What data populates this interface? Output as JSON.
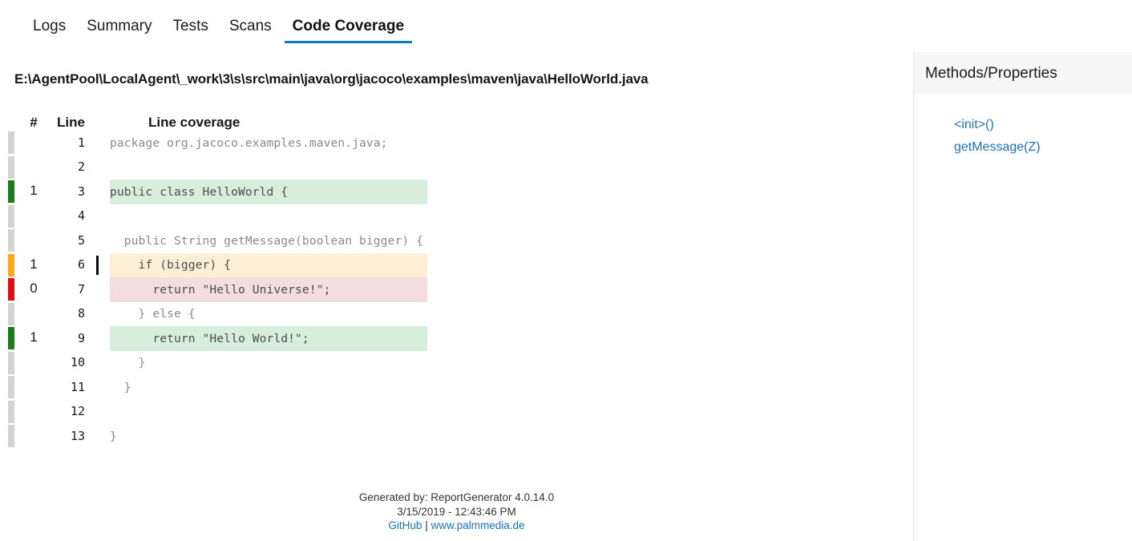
{
  "tabs": [
    {
      "label": "Logs",
      "active": false
    },
    {
      "label": "Summary",
      "active": false
    },
    {
      "label": "Tests",
      "active": false
    },
    {
      "label": "Scans",
      "active": false
    },
    {
      "label": "Code Coverage",
      "active": true
    }
  ],
  "file": {
    "path": "E:\\AgentPool\\LocalAgent\\_work\\3\\s\\src\\main\\java\\org\\jacoco\\examples\\maven\\java\\HelloWorld.java"
  },
  "table": {
    "headers": {
      "hits": "#",
      "line": "Line",
      "coverage": "Line coverage"
    },
    "rows": [
      {
        "hits": "",
        "line": "1",
        "status": "none",
        "tick": false,
        "code": "package org.jacoco.examples.maven.java;"
      },
      {
        "hits": "",
        "line": "2",
        "status": "none",
        "tick": false,
        "code": ""
      },
      {
        "hits": "1",
        "line": "3",
        "status": "covered",
        "tick": false,
        "code": "public class HelloWorld {"
      },
      {
        "hits": "",
        "line": "4",
        "status": "none",
        "tick": false,
        "code": ""
      },
      {
        "hits": "",
        "line": "5",
        "status": "none",
        "tick": false,
        "code": "  public String getMessage(boolean bigger) {"
      },
      {
        "hits": "1",
        "line": "6",
        "status": "partial",
        "tick": true,
        "code": "    if (bigger) {"
      },
      {
        "hits": "0",
        "line": "7",
        "status": "uncovered",
        "tick": false,
        "code": "      return \"Hello Universe!\";"
      },
      {
        "hits": "",
        "line": "8",
        "status": "none",
        "tick": false,
        "code": "    } else {"
      },
      {
        "hits": "1",
        "line": "9",
        "status": "covered",
        "tick": false,
        "code": "      return \"Hello World!\";"
      },
      {
        "hits": "",
        "line": "10",
        "status": "none",
        "tick": false,
        "code": "    }"
      },
      {
        "hits": "",
        "line": "11",
        "status": "none",
        "tick": false,
        "code": "  }"
      },
      {
        "hits": "",
        "line": "12",
        "status": "none",
        "tick": false,
        "code": ""
      },
      {
        "hits": "",
        "line": "13",
        "status": "none",
        "tick": false,
        "code": "}"
      }
    ]
  },
  "sidebar": {
    "title": "Methods/Properties",
    "items": [
      {
        "label": "<init>()"
      },
      {
        "label": "getMessage(Z)"
      }
    ]
  },
  "footer": {
    "generated_by": "Generated by: ReportGenerator 4.0.14.0",
    "timestamp": "3/15/2019 - 12:43:46 PM",
    "github_link": "GitHub",
    "separator": "|",
    "site_link": "www.palmmedia.de"
  },
  "colors": {
    "accent": "#0d7ac4",
    "covered": "#1c7b1c",
    "partial": "#fba919",
    "uncovered": "#e00e0e",
    "none": "#d3d3d3",
    "covered_bg": "#d8eedc",
    "partial_bg": "#fdeed6",
    "uncovered_bg": "#f4dde1",
    "link": "#1a72c4"
  }
}
